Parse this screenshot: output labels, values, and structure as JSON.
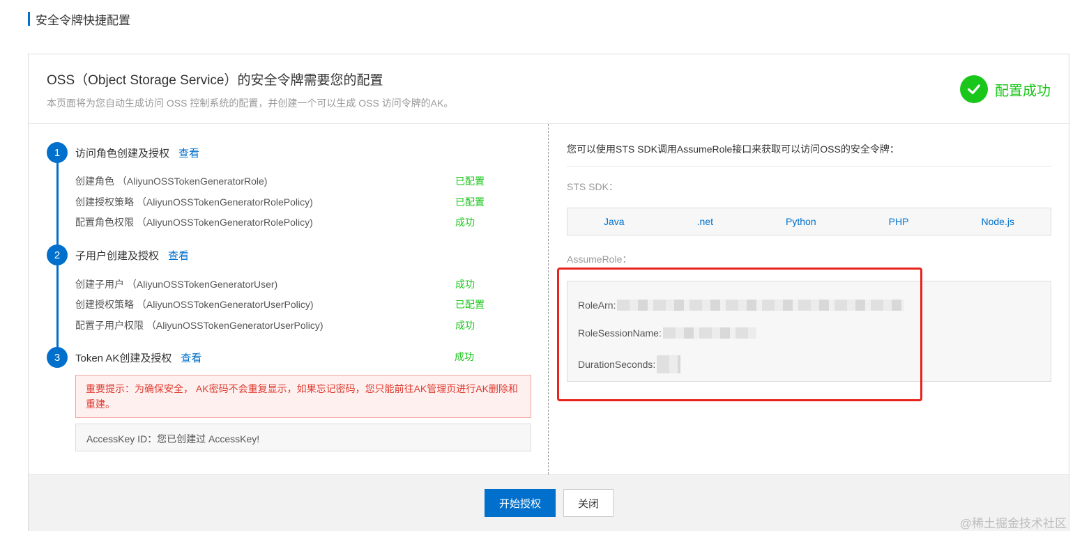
{
  "page": {
    "title": "安全令牌快捷配置"
  },
  "header": {
    "title": "OSS（Object Storage Service）的安全令牌需要您的配置",
    "description": "本页面将为您自动生成访问 OSS 控制系统的配置，并创建一个可以生成 OSS 访问令牌的AK。",
    "status": "配置成功"
  },
  "steps": [
    {
      "number": "1",
      "label": "访问角色创建及授权",
      "link": "查看",
      "items": [
        {
          "label": "创建角色 （AliyunOSSTokenGeneratorRole)",
          "status": "已配置"
        },
        {
          "label": "创建授权策略 （AliyunOSSTokenGeneratorRolePolicy)",
          "status": "已配置"
        },
        {
          "label": "配置角色权限 （AliyunOSSTokenGeneratorRolePolicy)",
          "status": "成功"
        }
      ]
    },
    {
      "number": "2",
      "label": "子用户创建及授权",
      "link": "查看",
      "items": [
        {
          "label": "创建子用户 （AliyunOSSTokenGeneratorUser)",
          "status": "成功"
        },
        {
          "label": "创建授权策略 （AliyunOSSTokenGeneratorUserPolicy)",
          "status": "已配置"
        },
        {
          "label": "配置子用户权限 （AliyunOSSTokenGeneratorUserPolicy)",
          "status": "成功"
        }
      ]
    },
    {
      "number": "3",
      "label": "Token AK创建及授权",
      "link": "查看",
      "status": "成功"
    }
  ],
  "warning": "重要提示：为确保安全， AK密码不会重复显示，如果忘记密码，您只能前往AK管理页进行AK删除和重建。",
  "access_key": "AccessKey ID：您已创建过 AccessKey!",
  "right": {
    "intro": "您可以使用STS SDK调用AssumeRole接口来获取可以访问OSS的安全令牌：",
    "sdk_label": "STS SDK：",
    "sdks": [
      "Java",
      ".net",
      "Python",
      "PHP",
      "Node.js"
    ],
    "assume_label": "AssumeRole：",
    "fields": {
      "role_arn": "RoleArn:",
      "role_session_name": "RoleSessionName:",
      "duration_seconds": "DurationSeconds:"
    }
  },
  "footer": {
    "primary": "开始授权",
    "close": "关闭"
  },
  "watermark": "@稀土掘金技术社区"
}
